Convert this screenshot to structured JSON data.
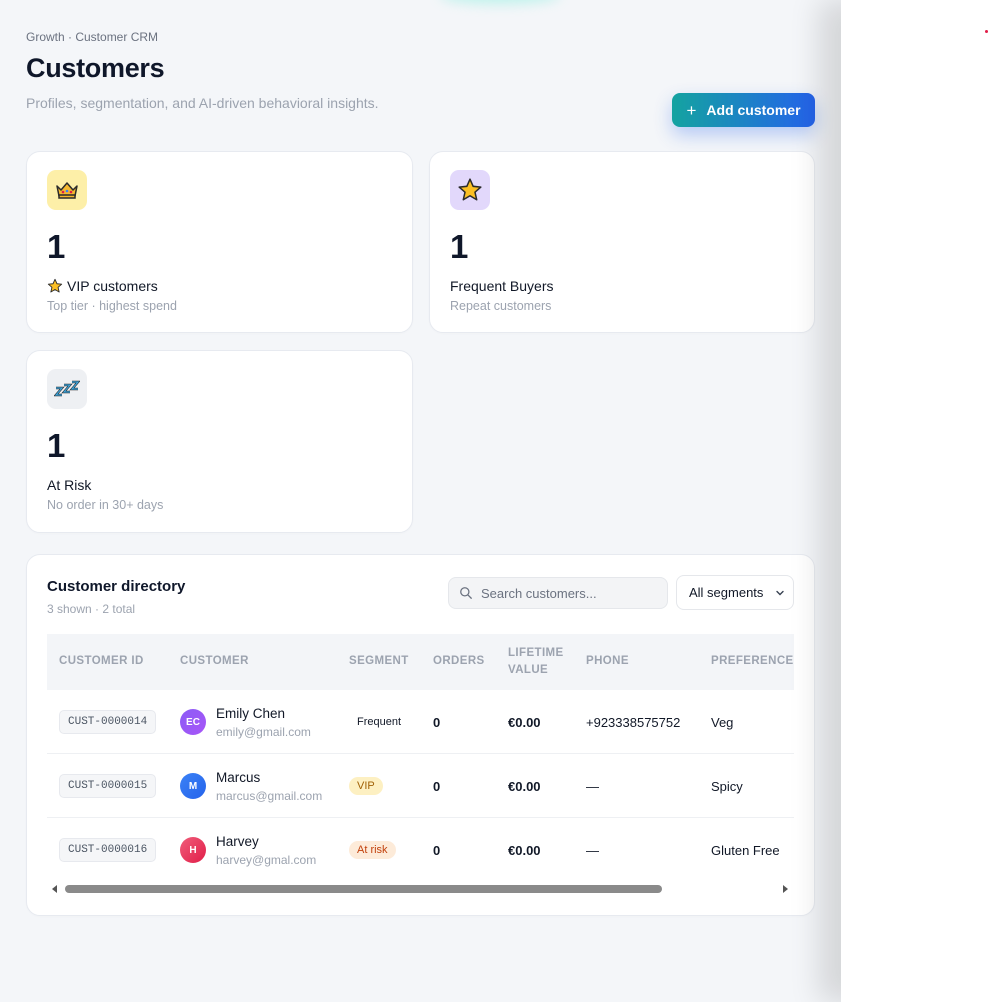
{
  "header": {
    "breadcrumb": "Growth · Customer CRM",
    "title": "Customers",
    "subtitle": "Profiles, segmentation, and AI-driven behavioral insights.",
    "add_button_label": "Add customer"
  },
  "stats": [
    {
      "value": "1",
      "label": "VIP customers",
      "label_prefix_icon": "star-icon",
      "sub": "Top tier · highest spend",
      "icon": "crown-icon",
      "icon_bg": "#fdefa8"
    },
    {
      "value": "1",
      "label": "Frequent Buyers",
      "sub": "Repeat customers",
      "icon": "star-icon",
      "icon_bg": "#e2d8fb"
    },
    {
      "value": "1",
      "label": "At Risk",
      "sub": "No order in 30+ days",
      "icon": "zzz-icon",
      "icon_bg": "#eef0f3"
    }
  ],
  "directory": {
    "title": "Customer directory",
    "subtitle": "3 shown · 2 total",
    "search_placeholder": "Search customers...",
    "segment_filter": "All segments",
    "columns": [
      "CUSTOMER ID",
      "CUSTOMER",
      "SEGMENT",
      "ORDERS",
      "LIFETIME VALUE",
      "PHONE",
      "PREFERENCE"
    ],
    "rows": [
      {
        "id": "CUST-0000014",
        "initials": "EC",
        "name": "Emily Chen",
        "email": "emily@gmail.com",
        "segment": "Frequent",
        "orders": "0",
        "lifetime_value": "€0.00",
        "phone": "+923338575752",
        "preference": "Veg",
        "avatar_color": "#8b5cf6"
      },
      {
        "id": "CUST-0000015",
        "initials": "M",
        "name": "Marcus",
        "email": "marcus@gmail.com",
        "segment": "VIP",
        "orders": "0",
        "lifetime_value": "€0.00",
        "phone": "—",
        "preference": "Spicy",
        "avatar_color": "#3b82f6"
      },
      {
        "id": "CUST-0000016",
        "initials": "H",
        "name": "Harvey",
        "email": "harvey@gmal.com",
        "segment": "At risk",
        "orders": "0",
        "lifetime_value": "€0.00",
        "phone": "—",
        "preference": "Gluten Free",
        "avatar_color": "#e94b6b"
      }
    ]
  },
  "colors": {
    "accent_start": "#14a3a0",
    "accent_end": "#2563eb"
  }
}
